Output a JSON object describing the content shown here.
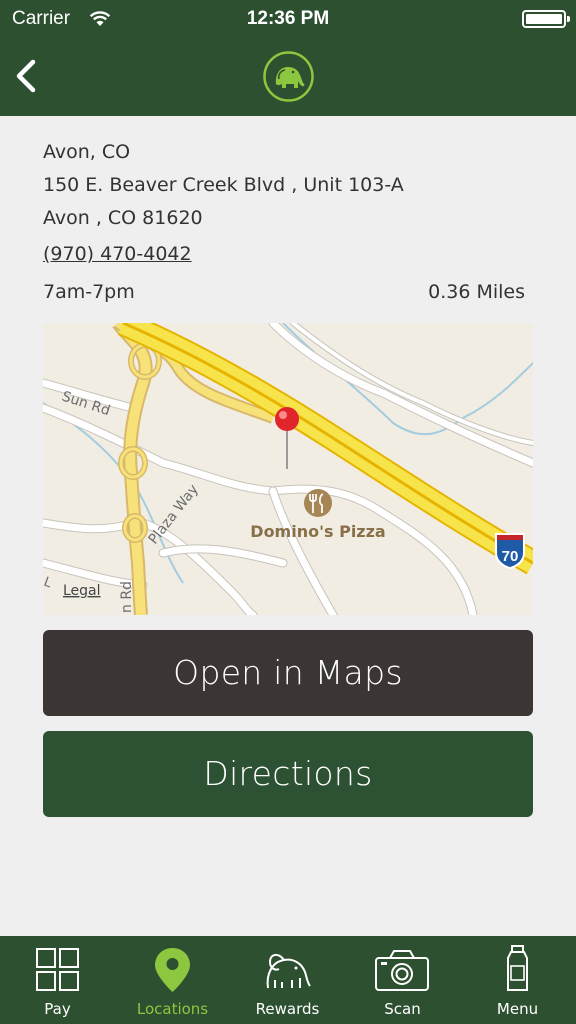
{
  "status_bar": {
    "carrier": "Carrier",
    "time": "12:36 PM"
  },
  "nav": {
    "back_icon": "chevron-left-icon",
    "logo_icon": "elephant-logo-icon"
  },
  "location": {
    "name": "Avon, CO",
    "address_line1": "150 E. Beaver Creek Blvd , Unit 103-A",
    "address_line2": "Avon , CO 81620",
    "phone": "(970) 470-4042",
    "hours": "7am-7pm",
    "distance": "0.36 Miles"
  },
  "map": {
    "road_labels": [
      "Sun Rd",
      "Plaza Way",
      "n Rd"
    ],
    "poi_label": "Domino's Pizza",
    "highway_shield": "70",
    "legal": "Legal",
    "partial_label": "L"
  },
  "buttons": {
    "open_in_maps": "Open in Maps",
    "directions": "Directions"
  },
  "tabs": [
    {
      "label": "Pay",
      "icon": "grid-icon",
      "active": false
    },
    {
      "label": "Locations",
      "icon": "map-pin-icon",
      "active": true
    },
    {
      "label": "Rewards",
      "icon": "elephant-icon",
      "active": false
    },
    {
      "label": "Scan",
      "icon": "camera-icon",
      "active": false
    },
    {
      "label": "Menu",
      "icon": "bottle-icon",
      "active": false
    }
  ],
  "colors": {
    "header_green": "#2d5030",
    "accent_green": "#8dc63f",
    "maps_button": "#3b3634",
    "directions_button": "#2c5233"
  }
}
